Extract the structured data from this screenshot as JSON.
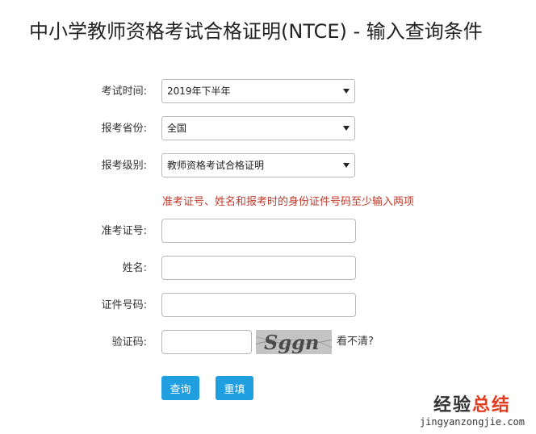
{
  "page": {
    "title": "中小学教师资格考试合格证明(NTCE) - 输入查询条件"
  },
  "form": {
    "exam_time": {
      "label": "考试时间:",
      "value": "2019年下半年"
    },
    "province": {
      "label": "报考省份:",
      "value": "全国"
    },
    "level": {
      "label": "报考级别:",
      "value": "教师资格考试合格证明"
    },
    "notice": "准考证号、姓名和报考时的身份证件号码至少输入两项",
    "admission_number": {
      "label": "准考证号:",
      "value": ""
    },
    "name": {
      "label": "姓名:",
      "value": ""
    },
    "id_number": {
      "label": "证件号码:",
      "value": ""
    },
    "captcha": {
      "label": "验证码:",
      "value": "",
      "image_text": "Sggn",
      "refresh_label": "看不清?"
    },
    "buttons": {
      "query_label": "查询",
      "reset_label": "重填"
    }
  },
  "watermark": {
    "main_prefix": "经验",
    "main_accent": "总结",
    "sub": "jingyanzongjie.com"
  },
  "colors": {
    "button": "#1f9ee0",
    "notice": "#c0392b",
    "watermark_accent": "#e23b1e"
  }
}
